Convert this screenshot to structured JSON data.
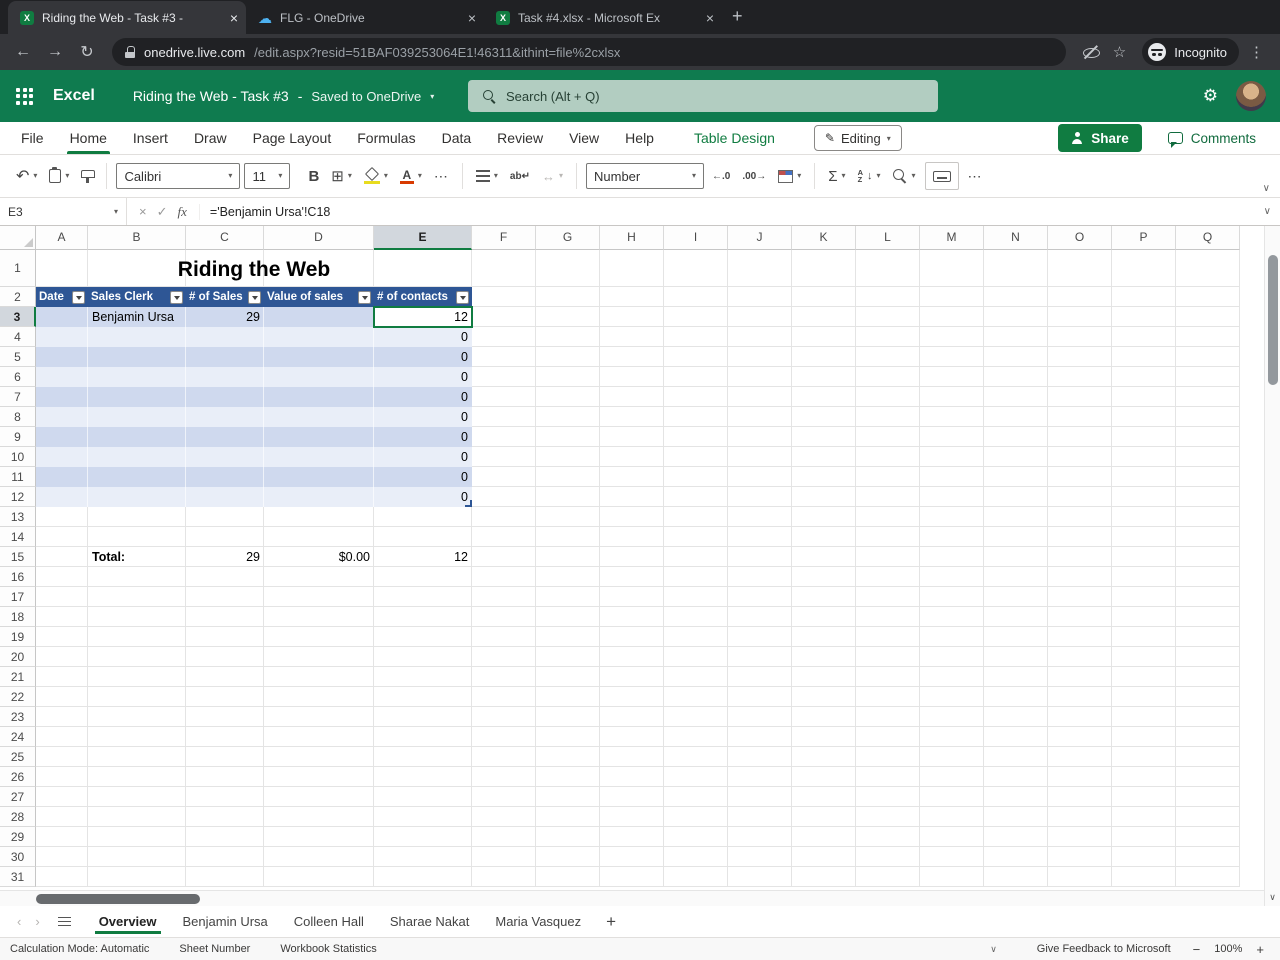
{
  "colors": {
    "excel_green": "#107C41",
    "table_header_blue": "#2E5695",
    "band_blue": "#CFD9EE",
    "band_blue_light": "#E9EEF8",
    "selection_green": "#107C41",
    "browser_dark": "#202124"
  },
  "browser": {
    "tabs": [
      {
        "icon": "excel-icon",
        "title": "Riding the Web - Task #3 -",
        "active": true
      },
      {
        "icon": "onedrive-icon",
        "title": "FLG - OneDrive",
        "active": false
      },
      {
        "icon": "excel-icon",
        "title": "Task #4.xlsx - Microsoft Ex",
        "active": false
      }
    ],
    "url_domain": "onedrive.live.com",
    "url_path": "/edit.aspx?resid=51BAF039253064E1!46311&ithint=file%2cxlsx",
    "incognito_label": "Incognito"
  },
  "app_header": {
    "app_name": "Excel",
    "doc_title": "Riding the Web - Task #3",
    "title_separator": "-",
    "saved_status": "Saved to OneDrive",
    "search_placeholder": "Search (Alt + Q)"
  },
  "menu": {
    "items": [
      {
        "label": "File"
      },
      {
        "label": "Home",
        "active": true
      },
      {
        "label": "Insert"
      },
      {
        "label": "Draw"
      },
      {
        "label": "Page Layout"
      },
      {
        "label": "Formulas"
      },
      {
        "label": "Data"
      },
      {
        "label": "Review"
      },
      {
        "label": "View"
      },
      {
        "label": "Help"
      },
      {
        "label": "Table Design",
        "contextual": true
      }
    ],
    "editing_label": "Editing",
    "share_label": "Share",
    "comments_label": "Comments"
  },
  "toolbar": {
    "font_name": "Calibri",
    "font_size": "11",
    "number_format": "Number"
  },
  "formula_bar": {
    "name_box": "E3",
    "formula": "='Benjamin Ursa'!C18"
  },
  "sheet": {
    "columns": [
      "A",
      "B",
      "C",
      "D",
      "E",
      "F",
      "G",
      "H",
      "I",
      "J",
      "K",
      "L",
      "M",
      "N",
      "O",
      "P",
      "Q"
    ],
    "rows": [
      1,
      2,
      3,
      4,
      5,
      6,
      7,
      8,
      9,
      10,
      11,
      12,
      13,
      14,
      15,
      16,
      17,
      18,
      19,
      20,
      21,
      22,
      23,
      24,
      25,
      26,
      27,
      28,
      29,
      30,
      31
    ],
    "title_text": "Riding the Web",
    "table": {
      "header_row": 2,
      "headers": [
        "Date",
        "Sales Clerk",
        "# of Sales",
        "Value of sales",
        "# of contacts"
      ],
      "data_rows": [
        3,
        4,
        5,
        6,
        7,
        8,
        9,
        10,
        11,
        12
      ]
    },
    "cells": [
      {
        "col": "B",
        "row": 3,
        "text": "Benjamin Ursa",
        "align": "left"
      },
      {
        "col": "C",
        "row": 3,
        "text": "29",
        "align": "right"
      },
      {
        "col": "E",
        "row": 3,
        "text": "12",
        "align": "right",
        "selected": true
      },
      {
        "col": "E",
        "row": 4,
        "text": "0",
        "align": "right"
      },
      {
        "col": "E",
        "row": 5,
        "text": "0",
        "align": "right"
      },
      {
        "col": "E",
        "row": 6,
        "text": "0",
        "align": "right"
      },
      {
        "col": "E",
        "row": 7,
        "text": "0",
        "align": "right"
      },
      {
        "col": "E",
        "row": 8,
        "text": "0",
        "align": "right"
      },
      {
        "col": "E",
        "row": 9,
        "text": "0",
        "align": "right"
      },
      {
        "col": "E",
        "row": 10,
        "text": "0",
        "align": "right"
      },
      {
        "col": "E",
        "row": 11,
        "text": "0",
        "align": "right"
      },
      {
        "col": "E",
        "row": 12,
        "text": "0",
        "align": "right"
      },
      {
        "col": "B",
        "row": 15,
        "text": "Total:",
        "align": "left",
        "bold": true
      },
      {
        "col": "C",
        "row": 15,
        "text": "29",
        "align": "right"
      },
      {
        "col": "D",
        "row": 15,
        "text": "$0.00",
        "align": "right"
      },
      {
        "col": "E",
        "row": 15,
        "text": "12",
        "align": "right"
      }
    ],
    "selection": {
      "col": "E",
      "row": 3
    }
  },
  "sheet_tabs": {
    "tabs": [
      "Overview",
      "Benjamin Ursa",
      "Colleen Hall",
      "Sharae Nakat",
      "Maria Vasquez"
    ],
    "active": "Overview",
    "add_label": "+"
  },
  "status_bar": {
    "items": [
      "Calculation Mode: Automatic",
      "Sheet Number",
      "Workbook Statistics"
    ],
    "feedback_label": "Give Feedback to Microsoft",
    "zoom_level": "100%"
  }
}
